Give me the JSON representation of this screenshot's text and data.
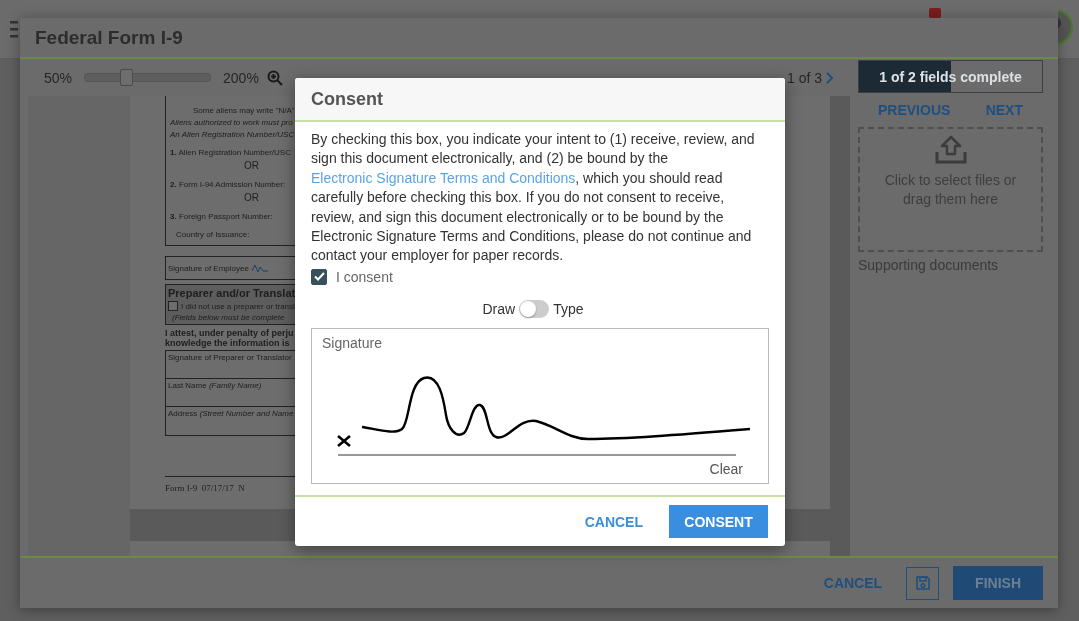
{
  "window": {
    "title": "Federal Form I-9"
  },
  "zoom": {
    "min_label": "50%",
    "max_label": "200%",
    "level": 0.33
  },
  "pager": {
    "label": "1 of 3"
  },
  "document": {
    "section_lines": [
      {
        "kind": "note",
        "text": "Some aliens may write \"N/A\""
      },
      {
        "kind": "italic",
        "text": "Aliens authorized to work must pro"
      },
      {
        "kind": "italic",
        "text": "An Alien Registration Number/USC"
      },
      {
        "kind": "item",
        "text": "**1.** Alien Registration Number/USC"
      },
      {
        "kind": "or",
        "text": "OR"
      },
      {
        "kind": "item",
        "text": "**2.** Form I-94 Admission Number:"
      },
      {
        "kind": "or",
        "text": "OR"
      },
      {
        "kind": "item",
        "text": "**3.** Foreign Passport Number:"
      },
      {
        "kind": "field",
        "text": "Country of Issuance:"
      }
    ],
    "employee_signature": "Signature of Employee",
    "preparer": {
      "heading": "Preparer and/or Translat",
      "checkbox_label": "I did not use a preparer or transl",
      "checked": false,
      "note": "(Fields below must be complete"
    },
    "attestation": [
      "I attest, under penalty of perju",
      "knowledge the information is"
    ],
    "rows": [
      "Signature of Preparer or Translator",
      "Last Name *(Family Name)*",
      "Address *(Street Number and Name*"
    ],
    "form_footer": "Form I-9  07/17/17  N"
  },
  "progress": {
    "label": "1 of 2 fields complete",
    "level": 0.5
  },
  "nav": {
    "previous": "PREVIOUS",
    "next": "NEXT"
  },
  "dropzone": {
    "text": "Click to select files or drag them here",
    "caption": "Supporting documents"
  },
  "footer": {
    "cancel": "CANCEL",
    "finish": "FINISH"
  },
  "dialog": {
    "title": "Consent",
    "body_before": "By checking this box, you indicate your intent to (1) receive, review, and sign this document electronically, and (2) be bound by the ",
    "link": "Electronic Signature Terms and Conditions",
    "body_after": ", which you should read carefully before checking this box. If you do not consent to receive, review, and sign this document electronically or to be bound by the Electronic Signature Terms and Conditions, please do not continue and contact your employer for paper records.",
    "consent_label": "I consent",
    "consent_checked": true,
    "mode_left": "Draw",
    "mode_right": "Type",
    "mode_type_on": false,
    "signature_label": "Signature",
    "clear": "Clear",
    "cancel": "CANCEL",
    "confirm": "CONSENT"
  }
}
